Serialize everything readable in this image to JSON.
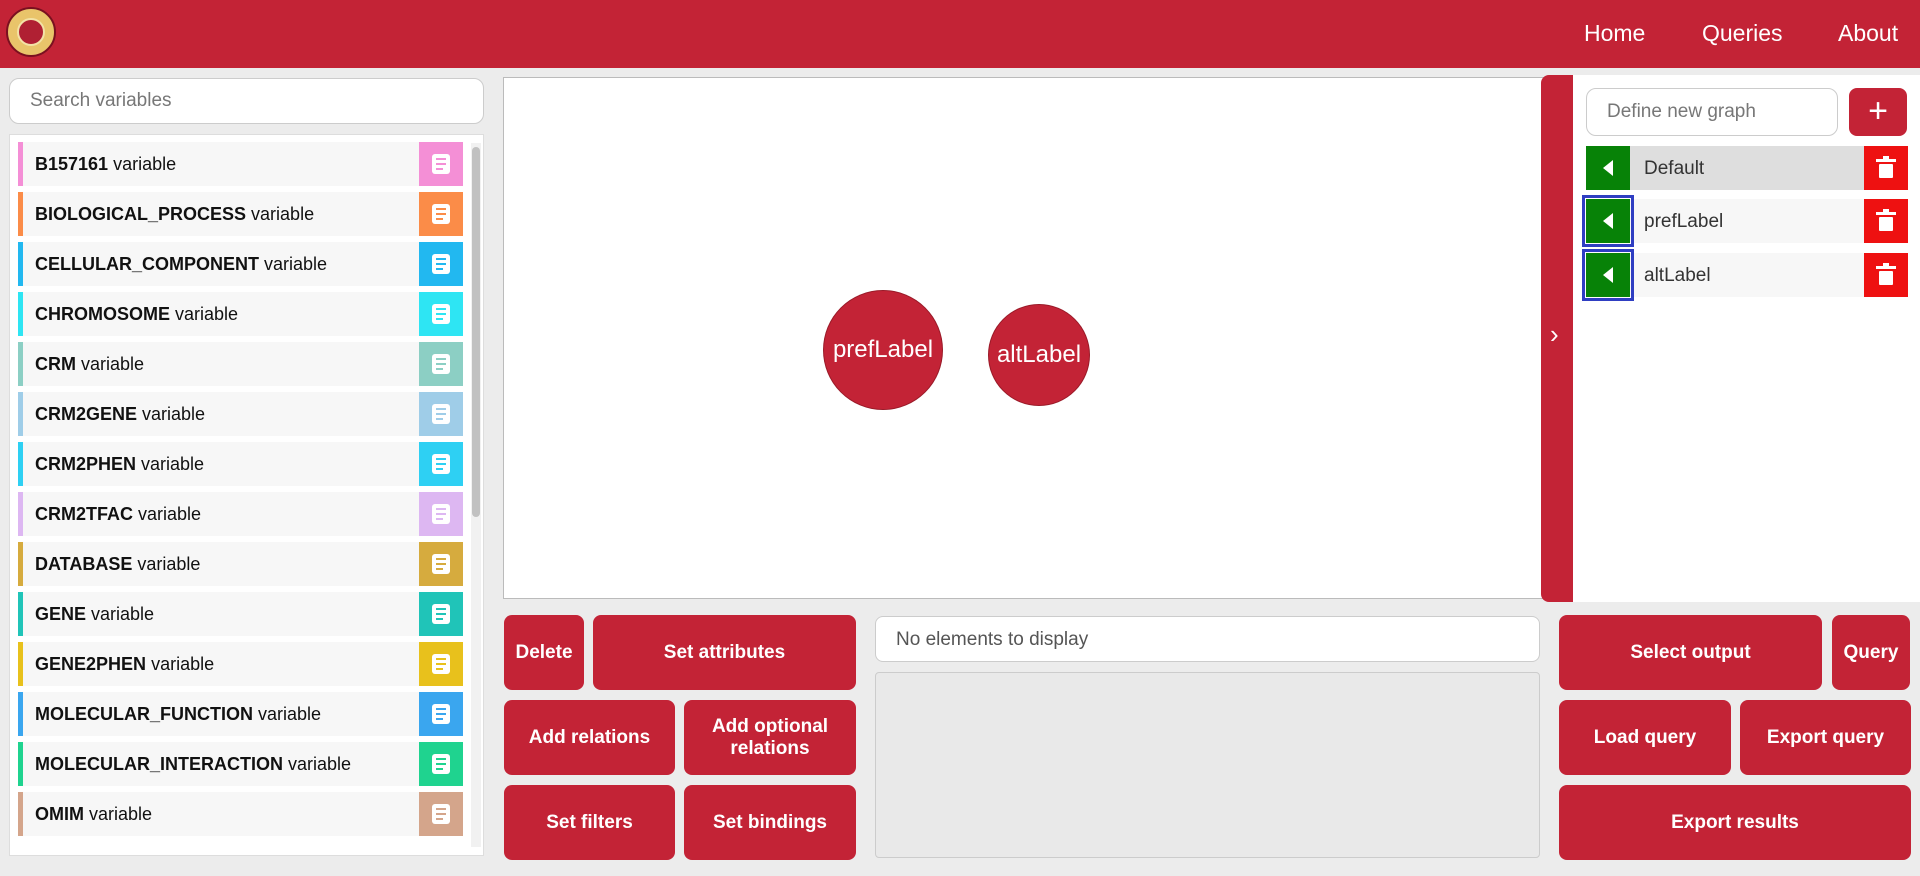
{
  "nav": {
    "home": "Home",
    "queries": "Queries",
    "about": "About"
  },
  "search": {
    "placeholder": "Search variables"
  },
  "variables": [
    {
      "name": "B157161",
      "suffix": "variable",
      "color": "#f48fd6"
    },
    {
      "name": "BIOLOGICAL_PROCESS",
      "suffix": "variable",
      "color": "#fb8c48"
    },
    {
      "name": "CELLULAR_COMPONENT",
      "suffix": "variable",
      "color": "#22b8f0"
    },
    {
      "name": "CHROMOSOME",
      "suffix": "variable",
      "color": "#2ee5f3"
    },
    {
      "name": "CRM",
      "suffix": "variable",
      "color": "#8ccfc4"
    },
    {
      "name": "CRM2GENE",
      "suffix": "variable",
      "color": "#9fcde8"
    },
    {
      "name": "CRM2PHEN",
      "suffix": "variable",
      "color": "#2ed0f3"
    },
    {
      "name": "CRM2TFAC",
      "suffix": "variable",
      "color": "#ddb7f2"
    },
    {
      "name": "DATABASE",
      "suffix": "variable",
      "color": "#d6ab3e"
    },
    {
      "name": "GENE",
      "suffix": "variable",
      "color": "#20c4b8"
    },
    {
      "name": "GENE2PHEN",
      "suffix": "variable",
      "color": "#e8c11c"
    },
    {
      "name": "MOLECULAR_FUNCTION",
      "suffix": "variable",
      "color": "#3aa6ef"
    },
    {
      "name": "MOLECULAR_INTERACTION",
      "suffix": "variable",
      "color": "#1fd38f"
    },
    {
      "name": "OMIM",
      "suffix": "variable",
      "color": "#d4a58b"
    }
  ],
  "canvas": {
    "nodes": [
      {
        "label": "prefLabel"
      },
      {
        "label": "altLabel"
      }
    ]
  },
  "graphs": {
    "input_placeholder": "Define new graph",
    "add_label": "+",
    "items": [
      {
        "name": "Default"
      },
      {
        "name": "prefLabel"
      },
      {
        "name": "altLabel"
      }
    ]
  },
  "actions": {
    "delete": "Delete",
    "set_attributes": "Set attributes",
    "add_relations": "Add relations",
    "add_optional_relations": "Add optional relations",
    "set_filters": "Set filters",
    "set_bindings": "Set bindings"
  },
  "elements": {
    "empty_text": "No elements to display"
  },
  "query_actions": {
    "select_output": "Select output",
    "query": "Query",
    "load_query": "Load query",
    "export_query": "Export query",
    "export_results": "Export results"
  },
  "colors": {
    "brand": "#c32336",
    "select_green": "#078207",
    "delete_red": "#ee1111",
    "focus_blue": "#2f3ec2"
  }
}
